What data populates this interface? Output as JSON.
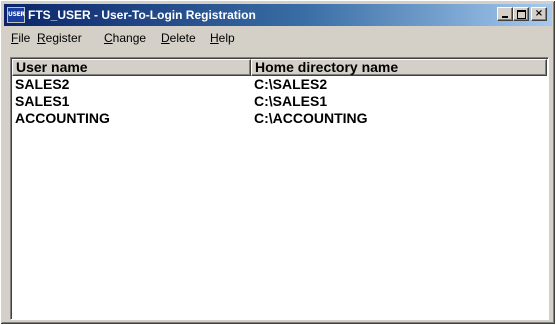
{
  "window": {
    "icon_text": "USER",
    "title": "FTS_USER - User-To-Login Registration",
    "minimize_icon": "minimize-icon",
    "maximize_icon": "maximize-icon",
    "close_icon": "close-icon",
    "close_glyph": "×"
  },
  "menu": [
    {
      "accel": "F",
      "rest": "ile"
    },
    {
      "accel": "R",
      "rest": "egister"
    },
    {
      "accel": "C",
      "rest": "hange"
    },
    {
      "accel": "D",
      "rest": "elete"
    },
    {
      "accel": "H",
      "rest": "elp"
    }
  ],
  "table": {
    "columns": [
      "User name",
      "Home directory name"
    ],
    "rows": [
      [
        "SALES2",
        "C:\\SALES2"
      ],
      [
        "SALES1",
        "C:\\SALES1"
      ],
      [
        "ACCOUNTING",
        "C:\\ACCOUNTING"
      ]
    ]
  },
  "colors": {
    "title_gradient_start": "#0a246a",
    "title_gradient_end": "#a6caf0",
    "face": "#d4d0c8"
  }
}
